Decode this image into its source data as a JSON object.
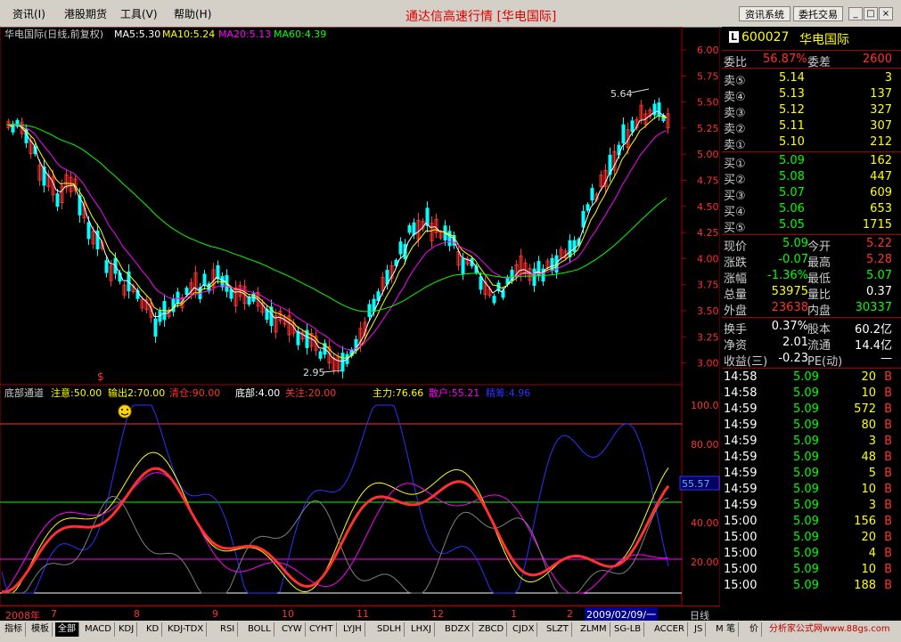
{
  "menu": [
    "资讯(I)",
    "港股期货",
    "工具(V)",
    "帮助(H)"
  ],
  "app_title": "通达信高速行情 [华电国际]",
  "sys_buttons": [
    "资讯系统",
    "委托交易"
  ],
  "window_controls": [
    "_",
    "□",
    "×"
  ],
  "main_chart": {
    "header_name": "华电国际(日线,前复权)",
    "ma": [
      {
        "label": "MA5:5.30",
        "color": "#ffffff"
      },
      {
        "label": "MA10:5.24",
        "color": "#ffff00"
      },
      {
        "label": "MA20:5.13",
        "color": "#ff00ff"
      },
      {
        "label": "MA60:4.39",
        "color": "#00ff00"
      }
    ],
    "y_ticks": [
      "6.00",
      "5.75",
      "5.50",
      "5.25",
      "5.00",
      "4.75",
      "4.50",
      "4.25",
      "4.00",
      "3.75",
      "3.50",
      "3.25",
      "3.00"
    ],
    "high_label": "5.64",
    "low_label": "2.95"
  },
  "indicator_chart": {
    "name": "底部通道",
    "params": [
      {
        "label": "注意:50.00",
        "color": "#ffff00"
      },
      {
        "label": "输出2:70.00",
        "color": "#ffff00"
      },
      {
        "label": "清仓:90.00",
        "color": "#ff3030"
      },
      {
        "label": "底部:4.00",
        "color": "#ffffff"
      },
      {
        "label": "关注:20.00",
        "color": "#ff3030"
      },
      {
        "label": "主力:76.66",
        "color": "#ffff00"
      },
      {
        "label": "散户:55.21",
        "color": "#ff00ff"
      },
      {
        "label": "精筹:4.96",
        "color": "#3030ff"
      }
    ],
    "y_ticks": [
      "100.0",
      "80.00",
      "60.00",
      "40.00",
      "20.00"
    ],
    "current_value": "55.57"
  },
  "date_axis": {
    "labels": [
      "2008年",
      "7",
      "8",
      "9",
      "10",
      "11",
      "12",
      "1",
      "2"
    ],
    "cursor_date": "2009/02/09/一",
    "period": "日线"
  },
  "sidebar": {
    "code": "600027",
    "name": "华电国际",
    "ratio_label": "委比",
    "ratio_value": "56.87%",
    "diff_label": "委差",
    "diff_value": "2600",
    "sells": [
      {
        "label": "卖⑤",
        "price": "5.14",
        "vol": "3"
      },
      {
        "label": "卖④",
        "price": "5.13",
        "vol": "137"
      },
      {
        "label": "卖③",
        "price": "5.12",
        "vol": "327"
      },
      {
        "label": "卖②",
        "price": "5.11",
        "vol": "307"
      },
      {
        "label": "卖①",
        "price": "5.10",
        "vol": "212"
      }
    ],
    "buys": [
      {
        "label": "买①",
        "price": "5.09",
        "vol": "162"
      },
      {
        "label": "买②",
        "price": "5.08",
        "vol": "447"
      },
      {
        "label": "买③",
        "price": "5.07",
        "vol": "609"
      },
      {
        "label": "买④",
        "price": "5.06",
        "vol": "653"
      },
      {
        "label": "买⑤",
        "price": "5.05",
        "vol": "1715"
      }
    ],
    "stats": [
      {
        "l1": "现价",
        "v1": "5.09",
        "c1": "#00ff00",
        "l2": "今开",
        "v2": "5.22",
        "c2": "#ff3030"
      },
      {
        "l1": "涨跌",
        "v1": "-0.07",
        "c1": "#00ff00",
        "l2": "最高",
        "v2": "5.28",
        "c2": "#ff3030"
      },
      {
        "l1": "涨幅",
        "v1": "-1.36%",
        "c1": "#00ff00",
        "l2": "最低",
        "v2": "5.07",
        "c2": "#00ff00"
      },
      {
        "l1": "总量",
        "v1": "53975",
        "c1": "#ffff00",
        "l2": "量比",
        "v2": "0.37",
        "c2": "#ffffff"
      },
      {
        "l1": "外盘",
        "v1": "23638",
        "c1": "#ff3030",
        "l2": "内盘",
        "v2": "30337",
        "c2": "#00ff00"
      }
    ],
    "fund": [
      {
        "l1": "换手",
        "v1": "0.37%",
        "l2": "股本",
        "v2": "60.2亿"
      },
      {
        "l1": "净资",
        "v1": "2.01",
        "l2": "流通",
        "v2": "14.4亿"
      },
      {
        "l1": "收益(三)",
        "v1": "-0.23",
        "l2": "PE(动)",
        "v2": "—"
      }
    ],
    "ticks": [
      {
        "t": "14:58",
        "p": "5.09",
        "v": "20",
        "d": "B"
      },
      {
        "t": "14:58",
        "p": "5.09",
        "v": "10",
        "d": "B"
      },
      {
        "t": "14:59",
        "p": "5.09",
        "v": "572",
        "d": "B"
      },
      {
        "t": "14:59",
        "p": "5.09",
        "v": "80",
        "d": "B"
      },
      {
        "t": "14:59",
        "p": "5.09",
        "v": "3",
        "d": "B"
      },
      {
        "t": "14:59",
        "p": "5.09",
        "v": "48",
        "d": "B"
      },
      {
        "t": "14:59",
        "p": "5.09",
        "v": "5",
        "d": "B"
      },
      {
        "t": "14:59",
        "p": "5.09",
        "v": "10",
        "d": "B"
      },
      {
        "t": "14:59",
        "p": "5.09",
        "v": "3",
        "d": "B"
      },
      {
        "t": "15:00",
        "p": "5.09",
        "v": "156",
        "d": "B"
      },
      {
        "t": "15:00",
        "p": "5.09",
        "v": "20",
        "d": "B"
      },
      {
        "t": "15:00",
        "p": "5.09",
        "v": "4",
        "d": "B"
      },
      {
        "t": "15:00",
        "p": "5.09",
        "v": "10",
        "d": "B"
      },
      {
        "t": "15:00",
        "p": "5.09",
        "v": "188",
        "d": "B"
      }
    ]
  },
  "bottom_tabs": [
    "指标",
    "模板",
    "全部",
    "MACD",
    "KDJ",
    "KD",
    "KDJ-TDX",
    "RSI",
    "BOLL",
    "CYW",
    "CYHT",
    "LYJH",
    "SDLH",
    "LHXJ",
    "BDZX",
    "ZBCD",
    "CJDX",
    "SLZT",
    "ZLMM",
    "SG-LB",
    "ACCER",
    "JS",
    "MFI"
  ],
  "footer": {
    "tab1": "笔",
    "tab2": "价",
    "site": "分析家公式网www.88gs.com"
  },
  "colors": {
    "up": "#ff3030",
    "down": "#00ffff",
    "grid": "#a00000"
  }
}
